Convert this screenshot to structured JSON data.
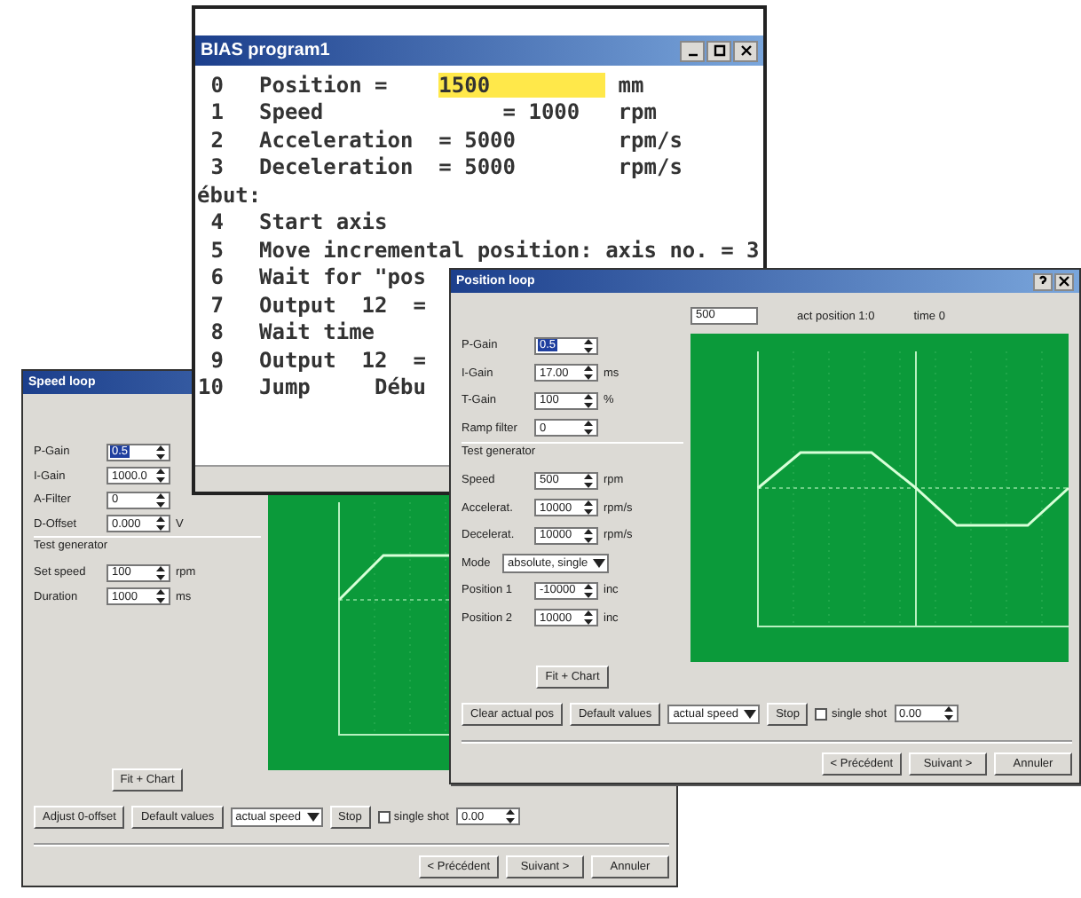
{
  "windows": [
    {
      "kind": "speed_loop",
      "title": "Speed loop",
      "params": [
        {
          "kind": "spin",
          "label": "P-Gain",
          "value": "0.5",
          "selected": true
        },
        {
          "kind": "spin",
          "label": "I-Gain",
          "value": "1000.0",
          "selected": false
        },
        {
          "kind": "spin",
          "label": "A-Filter",
          "value": "0",
          "selected": false
        },
        {
          "kind": "spin",
          "label": "D-Offset",
          "value": "0.000",
          "unit": "V",
          "selected": false
        },
        {
          "kind": "section",
          "label": "Test generator"
        },
        {
          "kind": "spin",
          "label": "Set speed",
          "value": "100",
          "unit": "rpm",
          "selected": false
        },
        {
          "kind": "spin",
          "label": "Duration",
          "value": "1000",
          "unit": "ms",
          "selected": false
        }
      ],
      "fit_button": "Fit + Chart",
      "bottom_row": [
        {
          "kind": "button",
          "label": "Adjust 0-offset"
        },
        {
          "kind": "button",
          "label": "Default values"
        },
        {
          "kind": "select",
          "value": "actual speed"
        },
        {
          "kind": "button",
          "label": "Stop"
        },
        {
          "kind": "checkbox",
          "label": "single shot",
          "checked": false
        },
        {
          "kind": "spin",
          "value": "0.00",
          "selected": false
        }
      ],
      "footer": [
        "< Précédent",
        "Suivant >",
        "Annuler"
      ]
    },
    {
      "kind": "program",
      "title": "BIAS program1",
      "lines": [
        {
          "kind": "cmd",
          "no": "0",
          "text": "Position =    ",
          "value": "1500",
          "unit": "mm",
          "highlighted": true
        },
        {
          "kind": "cmd",
          "no": "1",
          "text": "Speed              = 1000   rpm"
        },
        {
          "kind": "cmd",
          "no": "2",
          "text": "Acceleration  = 5000        rpm/s"
        },
        {
          "kind": "cmd",
          "no": "3",
          "text": "Deceleration  = 5000        rpm/s"
        },
        {
          "kind": "label",
          "text": "ébut:"
        },
        {
          "kind": "cmd",
          "no": "4",
          "text": "Start axis"
        },
        {
          "kind": "cmd",
          "no": "5",
          "text": "Move incremental position: axis no. = 3"
        },
        {
          "kind": "cmd",
          "no": "6",
          "text": "Wait for \"pos"
        },
        {
          "kind": "cmd",
          "no": "7",
          "text": "Output  12  ="
        },
        {
          "kind": "cmd",
          "no": "8",
          "text": "Wait time"
        },
        {
          "kind": "cmd",
          "no": "9",
          "text": "Output  12  ="
        },
        {
          "kind": "cmd",
          "no": "10",
          "text": "Jump     Débu"
        }
      ]
    },
    {
      "kind": "position_loop",
      "title": "Position loop",
      "params": [
        {
          "kind": "spin",
          "label": "P-Gain",
          "value": "0.5",
          "selected": true
        },
        {
          "kind": "spin",
          "label": "I-Gain",
          "value": "17.00",
          "unit": "ms",
          "selected": false
        },
        {
          "kind": "spin",
          "label": "T-Gain",
          "value": "100",
          "unit": "%",
          "selected": false
        },
        {
          "kind": "spin",
          "label": "Ramp filter",
          "value": "0",
          "selected": false
        },
        {
          "kind": "section",
          "label": "Test generator"
        },
        {
          "kind": "spin",
          "label": "Speed",
          "value": "500",
          "unit": "rpm",
          "selected": false
        },
        {
          "kind": "spin",
          "label": "Accelerat.",
          "value": "10000",
          "unit": "rpm/s",
          "selected": false
        },
        {
          "kind": "spin",
          "label": "Decelerat.",
          "value": "10000",
          "unit": "rpm/s",
          "selected": false
        },
        {
          "kind": "select",
          "label": "Mode",
          "value": "absolute, single"
        },
        {
          "kind": "spin",
          "label": "Position 1",
          "value": "-10000",
          "unit": "inc",
          "selected": false
        },
        {
          "kind": "spin",
          "label": "Position 2",
          "value": "10000",
          "unit": "inc",
          "selected": false
        }
      ],
      "fit_button": "Fit + Chart",
      "chart_header": {
        "field": "500",
        "labels": [
          "act position 1:0",
          "time 0"
        ]
      },
      "bottom_row": [
        {
          "kind": "button",
          "label": "Clear actual pos"
        },
        {
          "kind": "button",
          "label": "Default values"
        },
        {
          "kind": "select",
          "value": "actual speed"
        },
        {
          "kind": "button",
          "label": "Stop"
        },
        {
          "kind": "checkbox",
          "label": "single shot",
          "checked": false
        },
        {
          "kind": "spin",
          "value": "0.00",
          "selected": false
        }
      ],
      "footer": [
        "< Précédent",
        "Suivant >",
        "Annuler"
      ]
    }
  ]
}
